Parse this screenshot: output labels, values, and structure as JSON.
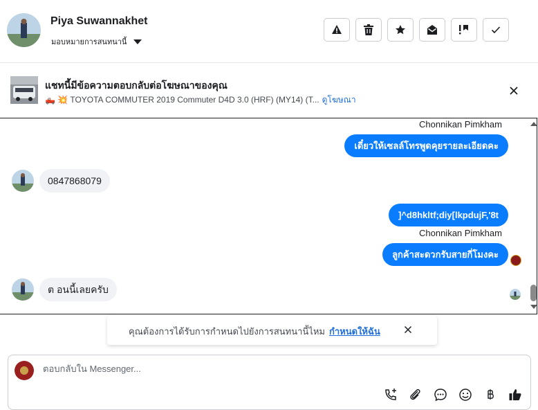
{
  "header": {
    "contact_name": "Piya Suwannakhet",
    "assign_label": "มอบหมายการสนทนานี้",
    "actions": [
      {
        "name": "report",
        "icon": "warning-icon"
      },
      {
        "name": "delete",
        "icon": "trash-icon"
      },
      {
        "name": "star",
        "icon": "star-icon"
      },
      {
        "name": "mark-unread",
        "icon": "open-envelope-icon"
      },
      {
        "name": "follow-up",
        "icon": "follow-up-icon"
      },
      {
        "name": "done",
        "icon": "check-icon"
      }
    ]
  },
  "ad_banner": {
    "title": "แชทนี้มีข้อความตอบกลับต่อโฆษณาของคุณ",
    "subtitle": "🛻 💥 TOYOTA COMMUTER 2019 Commuter D4D 3.0 (HRF) (MY14) (T...",
    "link": "ดูโฆษณา"
  },
  "messages": [
    {
      "sender": "Chonnikan Pimkham",
      "direction": "out",
      "text": "เดี๋ยวให้เซลล์โทรพูดคุยรายละเอียดคะ"
    },
    {
      "direction": "in",
      "text": "0847868079"
    },
    {
      "direction": "out",
      "text": "]^d8hkltf;diy[lkpdujF,'8t"
    },
    {
      "sender": "Chonnikan Pimkham",
      "direction": "out",
      "text": "ลูกค้าสะดวกรับสายกี่โมงคะ"
    },
    {
      "direction": "in",
      "text": "ต อนนี้เลยครับ"
    }
  ],
  "notice": {
    "text": "คุณต้องการได้รับการกำหนดไปยังการสนทนานี้ไหม",
    "link": "กำหนดให้ฉัน"
  },
  "composer": {
    "placeholder": "ตอบกลับใน Messenger...",
    "tools": [
      "call-add-icon",
      "paperclip-icon",
      "chat-bubble-icon",
      "smiley-icon",
      "baht-icon",
      "thumbs-up-icon"
    ]
  },
  "colors": {
    "accent": "#0a7cff",
    "link": "#216fdb",
    "incoming_bubble": "#f0f2f5"
  }
}
